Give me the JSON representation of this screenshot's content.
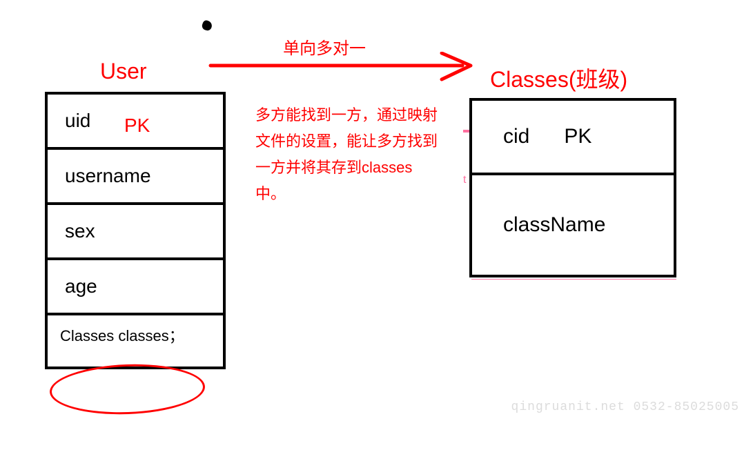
{
  "diagram": {
    "relationship_label": "单向多对一",
    "description": "多方能找到一方，通过映射文件的设置，能让多方找到一方并将其存到classes中。"
  },
  "entities": {
    "user": {
      "title": "User",
      "pk_label": "PK",
      "fields": {
        "f1": "uid",
        "f2": "username",
        "f3": "sex",
        "f4": "age",
        "f5": "Classes classes；"
      }
    },
    "classes": {
      "title": "Classes(班级)",
      "pk_label": "PK",
      "fields": {
        "f1": "cid",
        "f2": "className"
      }
    }
  },
  "watermark": "qingruanit.net 0532-85025005"
}
